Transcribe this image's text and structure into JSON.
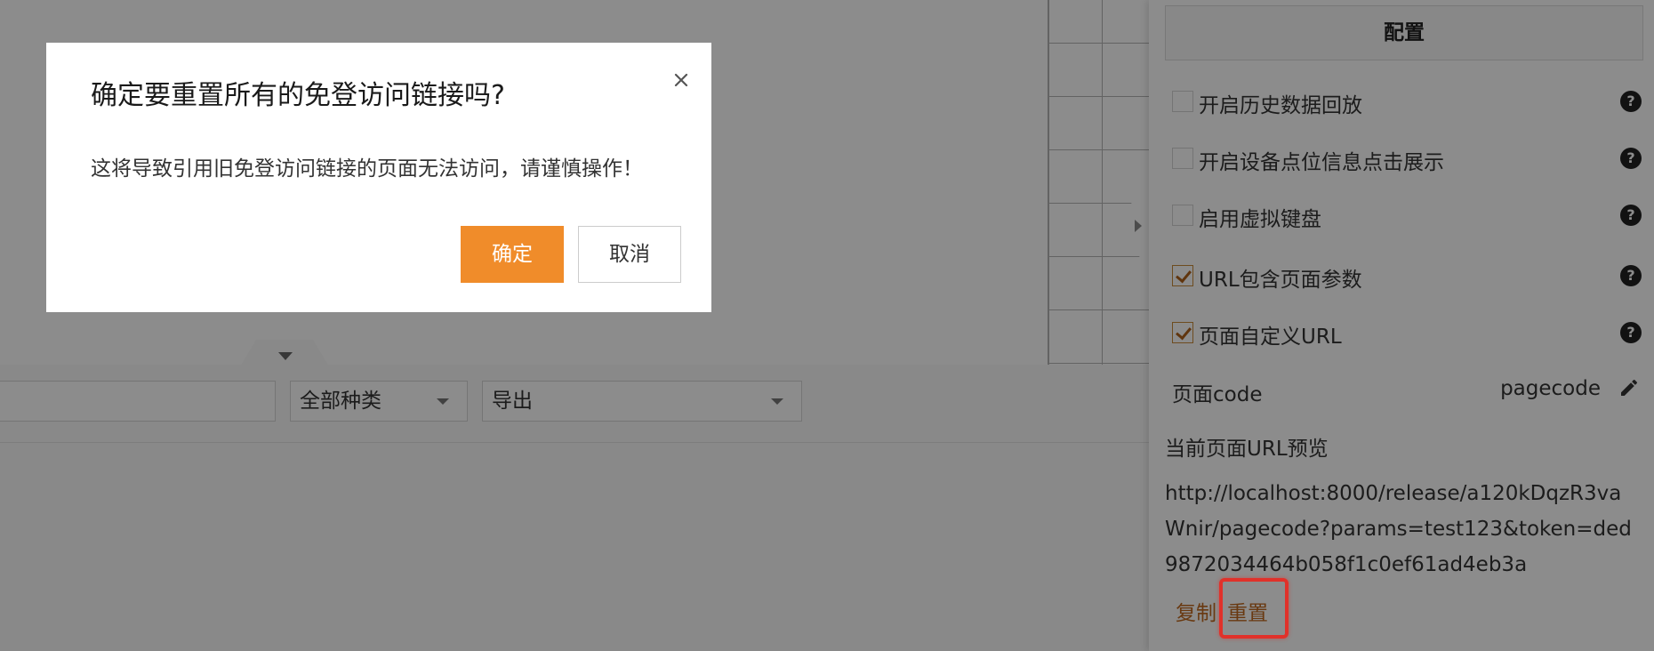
{
  "modal": {
    "title": "确定要重置所有的免登访问链接吗?",
    "body": "这将导致引用旧免登访问链接的页面无法访问，请谨慎操作！",
    "confirm_label": "确定",
    "cancel_label": "取消",
    "close_icon": "close-icon"
  },
  "filters": {
    "search_value": "",
    "category_value": "全部种类",
    "export_value": "导出"
  },
  "panel": {
    "header": "配置",
    "options": [
      {
        "label": "开启历史数据回放",
        "checked": false
      },
      {
        "label": "开启设备点位信息点击展示",
        "checked": false
      },
      {
        "label": " 启用虚拟键盘",
        "checked": false
      },
      {
        "label": "URL包含页面参数",
        "checked": true
      },
      {
        "label": "页面自定义URL",
        "checked": true
      }
    ],
    "help_icon": "question-circle-icon",
    "page_code_label": "页面code",
    "page_code_value": "pagecode",
    "edit_icon": "pencil-icon",
    "url_preview_title": "当前页面URL预览",
    "url_preview": "http://localhost:8000/release/a120kDqzR3vaWnir/pagecode?params=test123&token=ded9872034464b058f1c0ef61ad4eb3a",
    "copy_label": "复制",
    "reset_label": "重置"
  },
  "colors": {
    "accent": "#f08c2a",
    "link": "#c0691f",
    "highlight": "#e0312a"
  }
}
